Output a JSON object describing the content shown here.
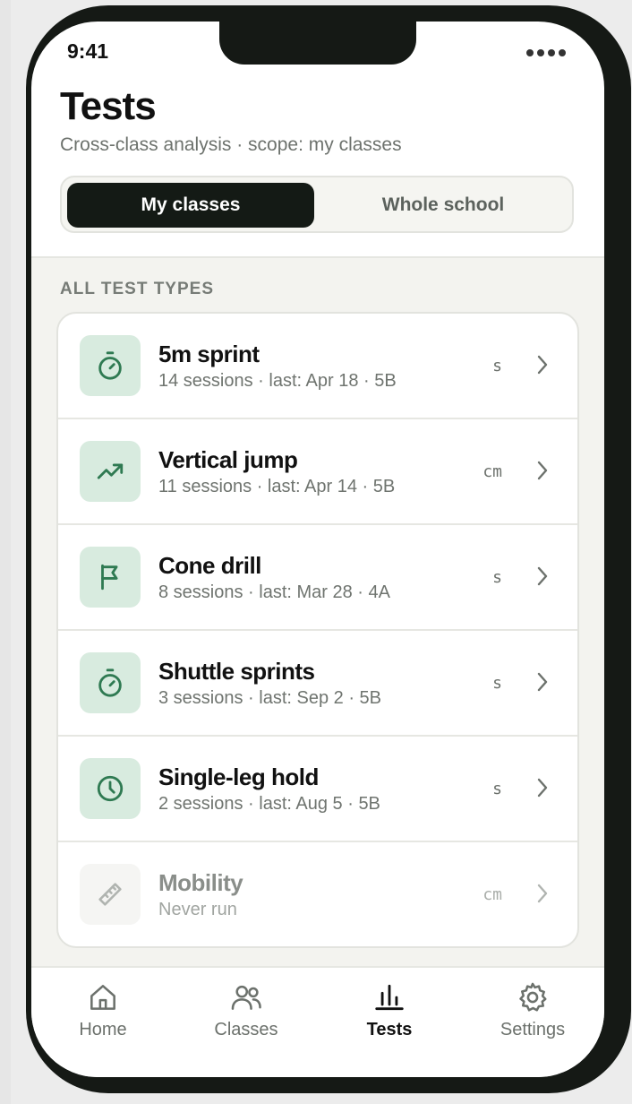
{
  "status": {
    "time": "9:41"
  },
  "header": {
    "title": "Tests",
    "subtitle": "Cross-class analysis · scope: my classes"
  },
  "scope_toggle": {
    "options": [
      "My classes",
      "Whole school"
    ],
    "selected": "My classes"
  },
  "section": {
    "label": "ALL TEST TYPES"
  },
  "tests": [
    {
      "name": "5m sprint",
      "meta": "14 sessions · last: Apr 18 · 5B",
      "unit": "s",
      "icon": "stopwatch-icon",
      "muted": false
    },
    {
      "name": "Vertical jump",
      "meta": "11 sessions · last: Apr 14 · 5B",
      "unit": "cm",
      "icon": "trend-up-icon",
      "muted": false
    },
    {
      "name": "Cone drill",
      "meta": "8 sessions · last: Mar 28 · 4A",
      "unit": "s",
      "icon": "flag-icon",
      "muted": false
    },
    {
      "name": "Shuttle sprints",
      "meta": "3 sessions · last: Sep 2 · 5B",
      "unit": "s",
      "icon": "stopwatch-icon",
      "muted": false
    },
    {
      "name": "Single-leg hold",
      "meta": "2 sessions · last: Aug 5 · 5B",
      "unit": "s",
      "icon": "clock-icon",
      "muted": false
    },
    {
      "name": "Mobility",
      "meta": "Never run",
      "unit": "cm",
      "icon": "ruler-icon",
      "muted": true
    }
  ],
  "tabbar": {
    "items": [
      {
        "label": "Home",
        "icon": "home-icon"
      },
      {
        "label": "Classes",
        "icon": "people-icon"
      },
      {
        "label": "Tests",
        "icon": "bar-chart-icon"
      },
      {
        "label": "Settings",
        "icon": "gear-icon"
      }
    ],
    "active": "Tests"
  },
  "colors": {
    "accent_dark": "#141a15",
    "icon_tile": "#d8ebdf",
    "icon_stroke": "#2f7a52"
  }
}
